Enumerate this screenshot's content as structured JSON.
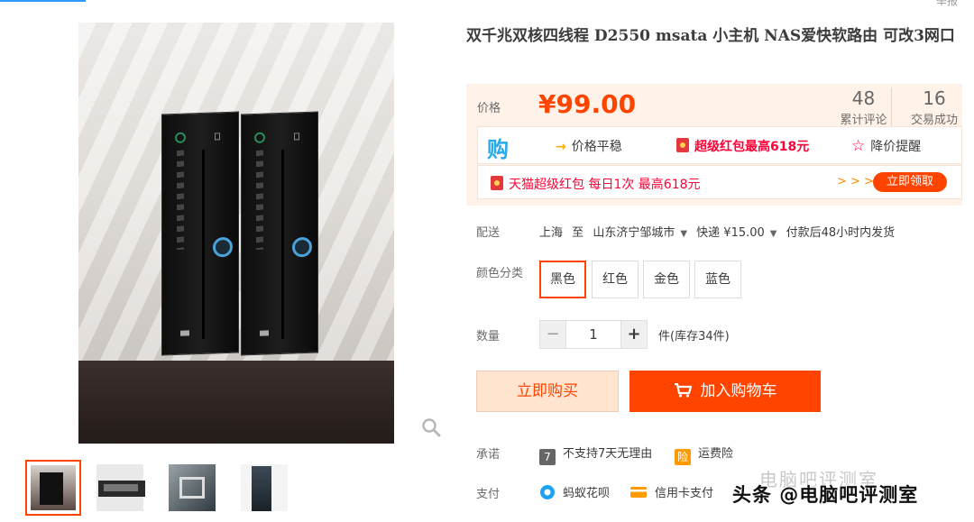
{
  "topbar": {
    "report": "举报"
  },
  "product": {
    "title": "双千兆双核四线程 D2550 msata 小主机 NAS爱快软路由 可改3网口"
  },
  "price": {
    "label": "价格",
    "value": "¥99.00",
    "reviews_count": "48",
    "reviews_label": "累计评论",
    "deals_count": "16",
    "deals_label": "交易成功"
  },
  "promo": {
    "gou": "购",
    "stable": "价格平稳",
    "redpack": "超级红包最高618元",
    "alert": "降价提醒"
  },
  "coupon": {
    "text": "天猫超级红包 每日1次 最高618元",
    "chevrons": "> > >",
    "claim": "立即领取"
  },
  "shipping": {
    "label": "配送",
    "from": "上海",
    "to_word": "至",
    "dest": "山东济宁邹城市",
    "method": "快递 ¥15.00",
    "eta": "付款后48小时内发货"
  },
  "color": {
    "label": "颜色分类",
    "options": [
      "黑色",
      "红色",
      "金色",
      "蓝色"
    ]
  },
  "quantity": {
    "label": "数量",
    "minus": "−",
    "value": "1",
    "plus": "+",
    "stock": "件(库存34件)"
  },
  "actions": {
    "buy_now": "立即购买",
    "add_cart": "加入购物车"
  },
  "promise": {
    "label": "承诺",
    "no_return": "不支持7天无理由",
    "no_return_badge": "7",
    "insurance": "运费险",
    "insurance_badge": "险"
  },
  "payment": {
    "label": "支付",
    "huabei": "蚂蚁花呗",
    "credit": "信用卡支付"
  },
  "watermark": {
    "faint": "电脑吧评测室",
    "main": "头条 @电脑吧评测室"
  },
  "colors": {
    "accent": "#ff4400",
    "red": "#ff0036",
    "panel": "#fff2e8",
    "link_blue": "#3399ff"
  }
}
